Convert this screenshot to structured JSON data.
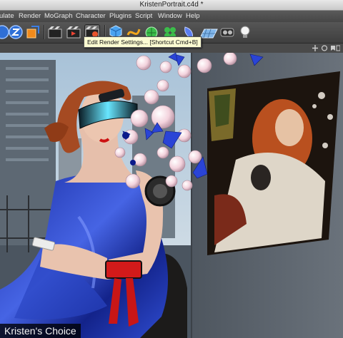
{
  "window": {
    "title": "KristenPortrait.c4d *"
  },
  "menu": [
    "ulate",
    "Render",
    "MoGraph",
    "Character",
    "Plugins",
    "Script",
    "Window",
    "Help"
  ],
  "toolbar": {
    "tooltip": "Edit Render Settings... [Shortcut Cmd+B]",
    "buttons": [
      "rotate-z-icon",
      "scale-z-icon",
      "coordinate-system-icon",
      "render-view-icon",
      "render-picture-viewer-icon",
      "render-settings-icon",
      "cube-icon",
      "spline-icon",
      "nurbs-icon",
      "mograph-cloner-icon",
      "deformer-icon",
      "floor-icon",
      "camera-icon",
      "light-icon"
    ]
  },
  "scene": {
    "caption": "Kristen's Choice"
  },
  "colors": {
    "satin": "#1a2fa8",
    "satin_highlight": "#4a66e6",
    "ribbon": "#d01818",
    "skin": "#e8c1ad",
    "hair": "#a44a22",
    "viewport_bg": "#5f6770"
  }
}
